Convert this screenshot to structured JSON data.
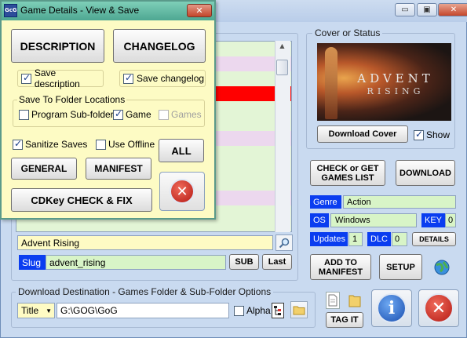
{
  "main_window": {
    "title_buttons": {
      "minimize": "▭",
      "restore": "▣",
      "close": "✕"
    }
  },
  "dialog": {
    "app_icon_text": "GcG",
    "title": "Game Details - View & Save",
    "close": "✕",
    "description_button": "DESCRIPTION",
    "changelog_button": "CHANGELOG",
    "save_description": "Save description",
    "save_changelog": "Save changelog",
    "folder_group_label": "Save To Folder Locations",
    "program_subfolder": "Program Sub-folder",
    "game": "Game",
    "games": "Games",
    "sanitize_saves": "Sanitize Saves",
    "use_offline": "Use Offline",
    "all_button": "ALL",
    "general_button": "GENERAL",
    "manifest_button": "MANIFEST",
    "cdkey_button": "CDKey CHECK & FIX"
  },
  "list": {
    "row_colors": [
      "#e3f5d6",
      "#ecd8ee",
      "#e3f5d6",
      "#ff0000",
      "#e3f5d6",
      "#e3f5d6",
      "#ecd8ee",
      "#e3f5d6",
      "#e3f5d6",
      "#e3f5d6",
      "#ecd8ee",
      "#e3f5d6",
      "#e3f5d6"
    ]
  },
  "selected_game": {
    "title": "Advent Rising",
    "slug_label": "Slug",
    "slug_value": "advent_rising",
    "sub_button": "SUB",
    "last_button": "Last"
  },
  "cover": {
    "group_label": "Cover or Status",
    "image_text_line1": "ADVENT",
    "image_text_line2": "RISING",
    "download_cover_button": "Download Cover",
    "show_label": "Show"
  },
  "actions": {
    "check_get_line1": "CHECK or GET",
    "check_get_line2": "GAMES LIST",
    "download_button": "DOWNLOAD"
  },
  "details": {
    "genre_label": "Genre",
    "genre_value": "Action",
    "os_label": "OS",
    "os_value": "Windows",
    "key_label": "KEY",
    "key_value": "0",
    "updates_label": "Updates",
    "updates_value": "1",
    "dlc_label": "DLC",
    "dlc_value": "0",
    "details_button": "DETAILS"
  },
  "bottom_actions": {
    "add_manifest_line1": "ADD TO",
    "add_manifest_line2": "MANIFEST",
    "setup_button": "SETUP",
    "tag_it_button": "TAG IT",
    "info_symbol": "i"
  },
  "download_destination": {
    "group_label": "Download Destination - Games Folder & Sub-Folder Options",
    "select_value": "Title",
    "path_value": "G:\\GOG\\GoG",
    "alpha_label": "Alpha"
  },
  "colors": {
    "accent_blue": "#0a3df0",
    "row_red": "#ff0000",
    "dialog_bg": "#fdfbc4"
  }
}
